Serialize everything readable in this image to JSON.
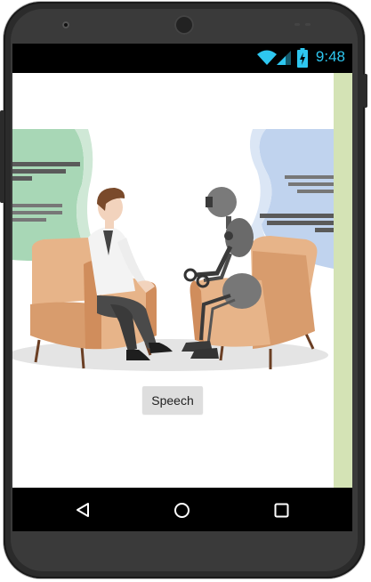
{
  "status_bar": {
    "time": "9:48",
    "icons": [
      "wifi-icon",
      "cellular-signal-icon",
      "battery-charging-icon"
    ],
    "accent_color": "#2ec7f0"
  },
  "app": {
    "illustration": "human-and-robot-conversation-illustration",
    "speech_button_label": "Speech",
    "right_panel_color": "#d4e3b5"
  },
  "nav_bar": {
    "icons": [
      "back-icon",
      "home-icon",
      "recents-icon"
    ]
  }
}
